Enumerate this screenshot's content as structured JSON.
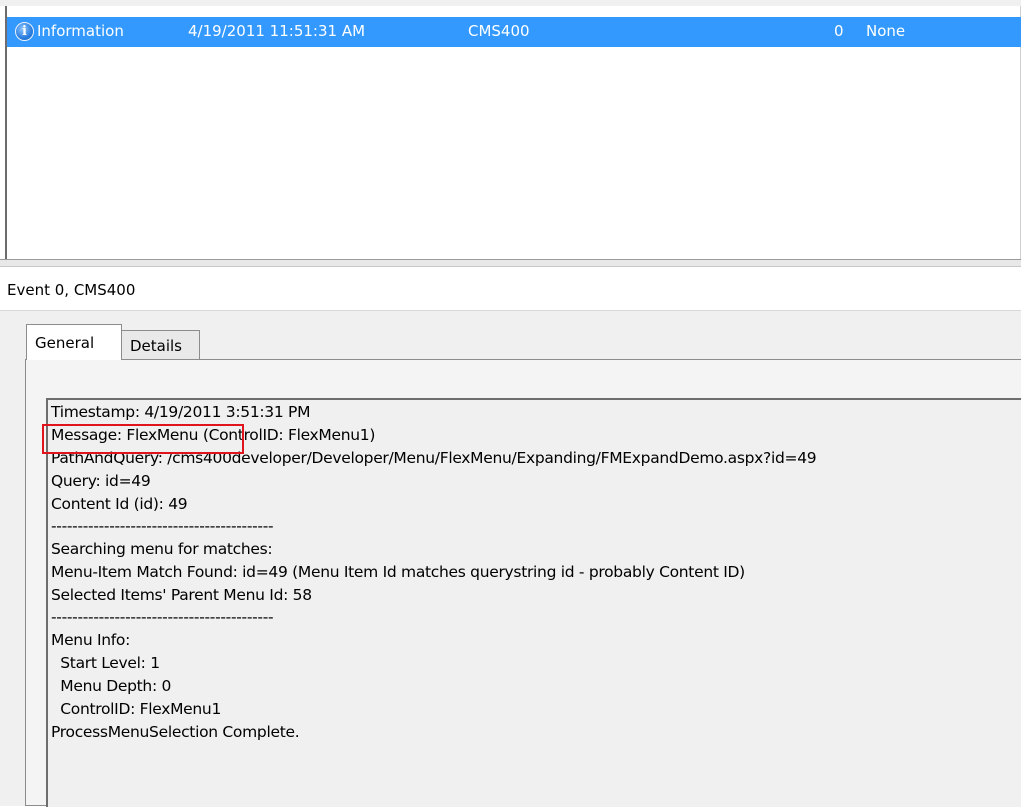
{
  "event_list": {
    "selected_row": {
      "level": "Information",
      "date_time": "4/19/2011 11:51:31 AM",
      "source": "CMS400",
      "event_id": "0",
      "task_category": "None"
    }
  },
  "detail": {
    "header": "Event 0, CMS400",
    "tabs": [
      {
        "label": "General",
        "active": true
      },
      {
        "label": "Details",
        "active": false
      }
    ],
    "message_lines": [
      "Timestamp: 4/19/2011 3:51:31 PM",
      "Message: FlexMenu (ControlID: FlexMenu1)",
      "PathAndQuery: /cms400developer/Developer/Menu/FlexMenu/Expanding/FMExpandDemo.aspx?id=49",
      "Query: id=49",
      "Content Id (id): 49",
      "------------------------------------------",
      "Searching menu for matches:",
      "Menu-Item Match Found: id=49 (Menu Item Id matches querystring id - probably Content ID)",
      "Selected Items' Parent Menu Id: 58",
      "------------------------------------------",
      "Menu Info:",
      "  Start Level: 1",
      "  Menu Depth: 0",
      "  ControlID: FlexMenu1",
      "ProcessMenuSelection Complete."
    ]
  },
  "colors": {
    "selection": "#3399ff",
    "highlight_box": "#e0141c",
    "panel_bg": "#f0f0f0"
  },
  "icons": {
    "row_icon": "information-icon"
  }
}
